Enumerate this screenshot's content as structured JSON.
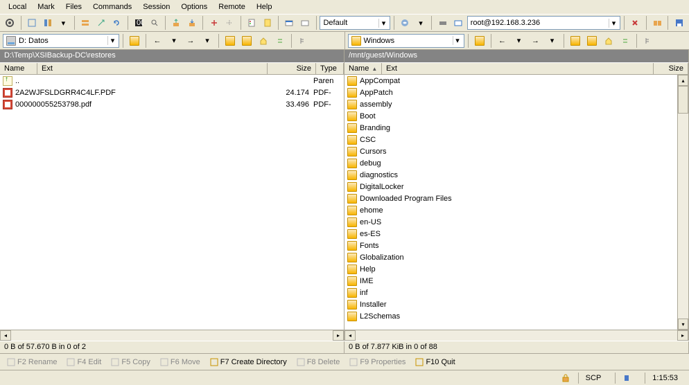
{
  "menus": [
    "Local",
    "Mark",
    "Files",
    "Commands",
    "Session",
    "Options",
    "Remote",
    "Help"
  ],
  "toolbar2_preset": "Default",
  "toolbar2_host": "root@192.168.3.236",
  "left": {
    "drive": "D: Datos",
    "path": "D:\\Temp\\XSIBackup-DC\\restores",
    "cols": {
      "name": "Name",
      "ext": "Ext",
      "size": "Size",
      "type": "Type"
    },
    "parent": "..",
    "parent_type": "Paren",
    "files": [
      {
        "name": "2A2WJFSLDGRR4C4LF.PDF",
        "size": "24.174",
        "type": "PDF-"
      },
      {
        "name": "000000055253798.pdf",
        "size": "33.496",
        "type": "PDF-"
      }
    ],
    "status": "0 B of 57.670 B in 0 of 2"
  },
  "right": {
    "drive": "Windows",
    "path": "/mnt/guest/Windows",
    "cols": {
      "name": "Name",
      "ext": "Ext",
      "size": "Size"
    },
    "folders": [
      "AppCompat",
      "AppPatch",
      "assembly",
      "Boot",
      "Branding",
      "CSC",
      "Cursors",
      "debug",
      "diagnostics",
      "DigitalLocker",
      "Downloaded Program Files",
      "ehome",
      "en-US",
      "es-ES",
      "Fonts",
      "Globalization",
      "Help",
      "IME",
      "inf",
      "Installer",
      "L2Schemas"
    ],
    "status": "0 B of 7.877 KiB in 0 of 88"
  },
  "fkeys": [
    {
      "key": "F2",
      "label": "Rename",
      "en": false
    },
    {
      "key": "F4",
      "label": "Edit",
      "en": false
    },
    {
      "key": "F5",
      "label": "Copy",
      "en": false
    },
    {
      "key": "F6",
      "label": "Move",
      "en": false
    },
    {
      "key": "F7",
      "label": "Create Directory",
      "en": true
    },
    {
      "key": "F8",
      "label": "Delete",
      "en": false
    },
    {
      "key": "F9",
      "label": "Properties",
      "en": false
    },
    {
      "key": "F10",
      "label": "Quit",
      "en": true
    }
  ],
  "bottom": {
    "proto": "SCP",
    "time": "1:15:53"
  }
}
